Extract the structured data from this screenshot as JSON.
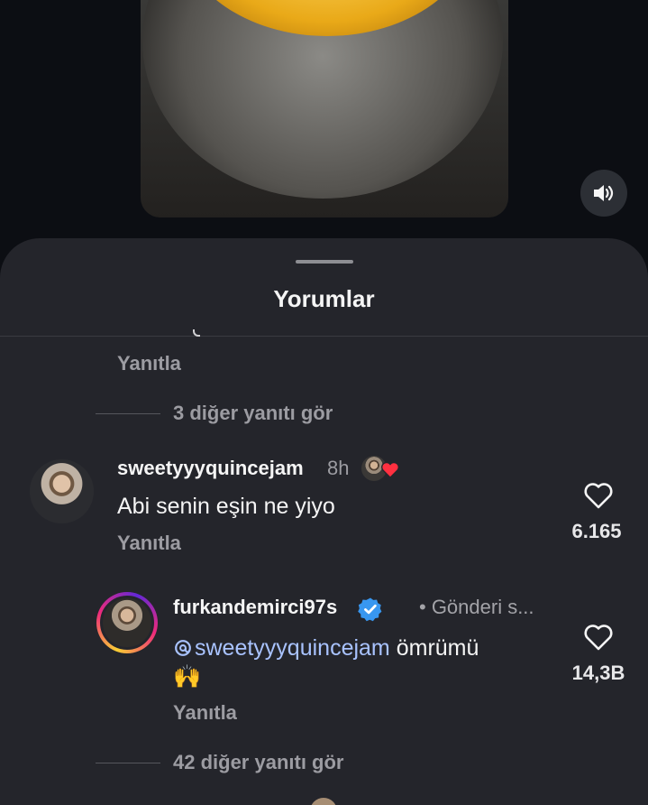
{
  "sheet": {
    "title": "Yorumlar"
  },
  "thread_top": {
    "reply_label": "Yanıtla",
    "more_replies": "3 diğer yanıtı gör"
  },
  "comment_1": {
    "username": "sweetyyyquincejam",
    "time": "8h",
    "text": "Abi senin eşin ne yiyo",
    "reply_label": "Yanıtla",
    "like_count": "6.165"
  },
  "comment_2": {
    "username": "furkandemirci97s",
    "meta": "• Gönderi s...",
    "mention": "sweetyyyquincejam",
    "text_rest": " ömrümü",
    "emoji": "🙌",
    "reply_label": "Yanıtla",
    "like_count": "14,3B",
    "more_replies": "42 diğer yanıtı gör"
  },
  "colors": {
    "sheet_bg": "#24252b",
    "mention": "#a9c3ff",
    "verified": "#3897f0",
    "heart_red": "#ff3040",
    "muted_text": "#9c9ca2"
  },
  "icons": {
    "sound": "speaker-on-icon",
    "like": "heart-outline-icon",
    "verified": "verified-badge-icon",
    "threads": "threads-logo-icon"
  }
}
